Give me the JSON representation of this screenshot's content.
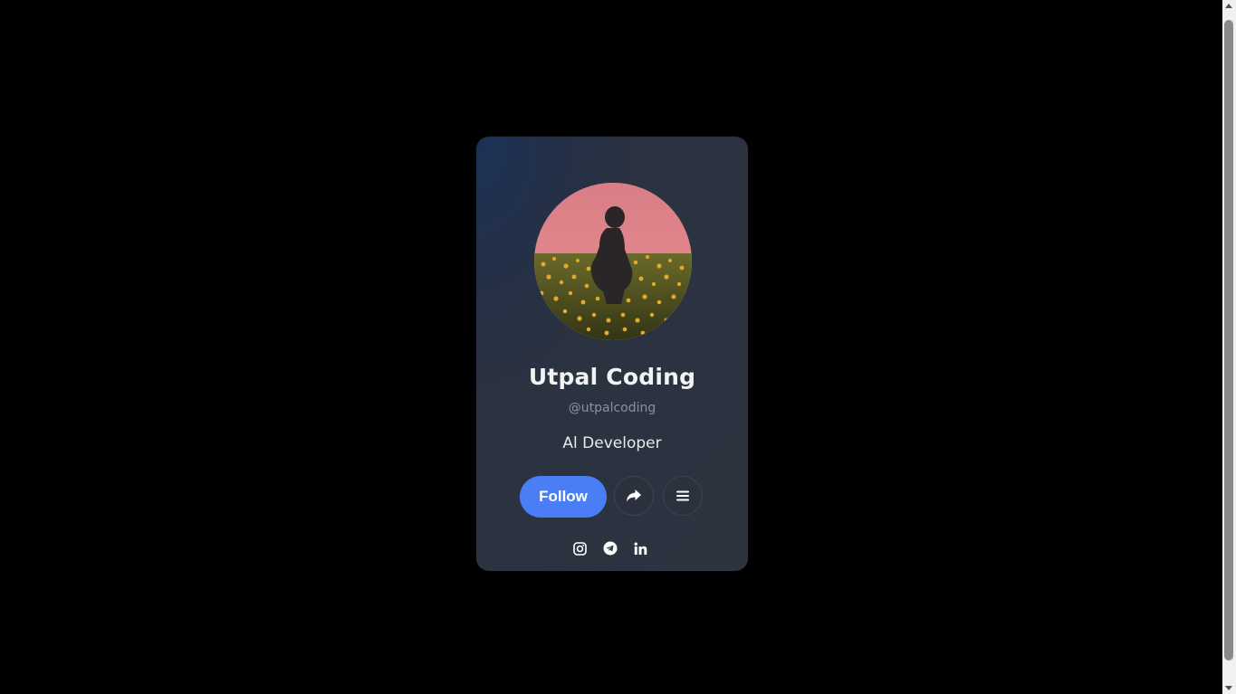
{
  "profile": {
    "name": "Utpal Coding",
    "handle": "@utpalcoding",
    "role": "Al Developer",
    "avatar_description": "person-in-flower-field-photo"
  },
  "actions": {
    "follow_label": "Follow",
    "share_icon": "share-icon",
    "menu_icon": "menu-icon"
  },
  "socials": [
    {
      "icon": "instagram-icon"
    },
    {
      "icon": "telegram-icon"
    },
    {
      "icon": "linkedin-icon"
    }
  ],
  "colors": {
    "page_background": "#000000",
    "card_background": "#2d333f",
    "accent": "#4a7ef6",
    "name_text": "#f1f2f4",
    "handle_text": "#8a909c"
  }
}
